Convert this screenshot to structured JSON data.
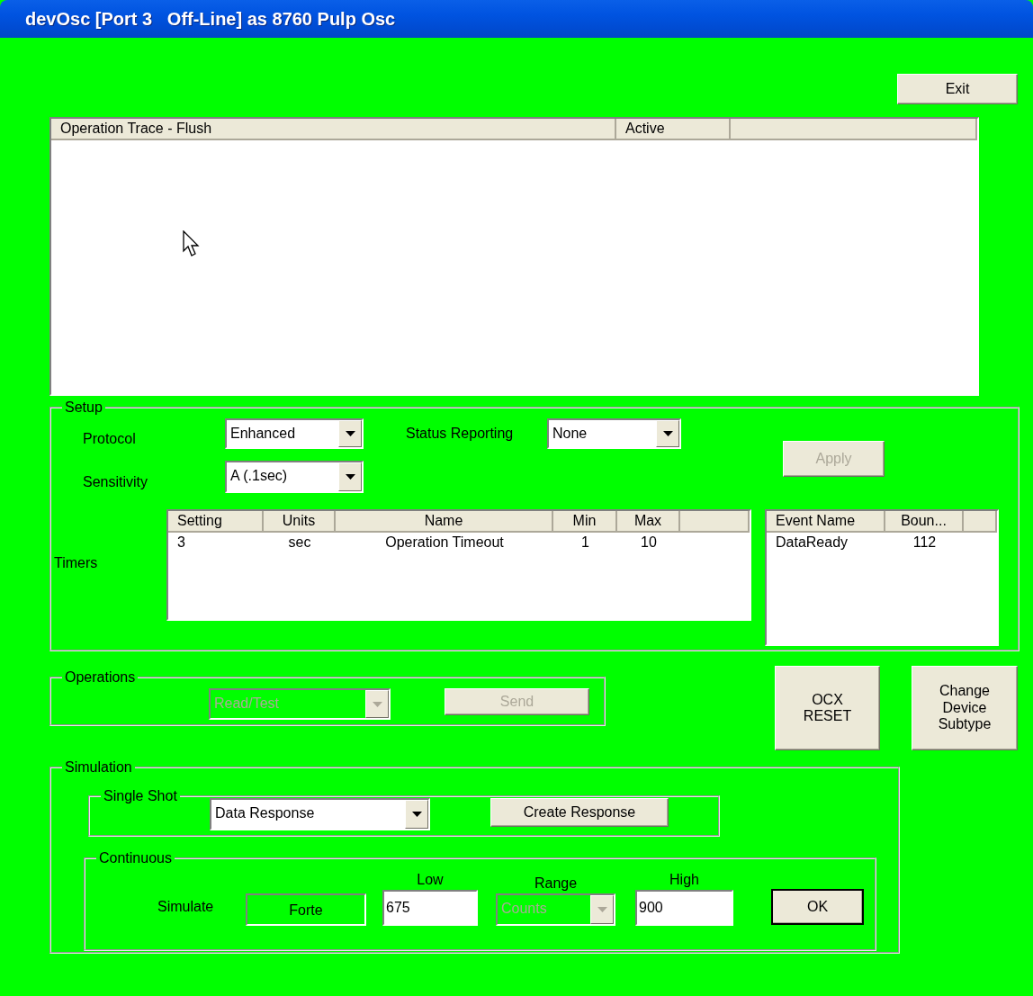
{
  "window": {
    "title": "devOsc [Port 3   Off-Line] as 8760 Pulp Osc"
  },
  "exit_button": {
    "label": "Exit"
  },
  "trace_list": {
    "columns": [
      "Operation Trace - Flush",
      "Active"
    ]
  },
  "setup": {
    "legend": "Setup",
    "protocol": {
      "label": "Protocol",
      "value": "Enhanced"
    },
    "status_reporting": {
      "label": "Status Reporting",
      "value": "None"
    },
    "sensitivity": {
      "label": "Sensitivity",
      "value": "A (.1sec)"
    },
    "apply_button": {
      "label": "Apply",
      "disabled": true
    },
    "timers": {
      "label": "Timers",
      "columns": [
        "Setting",
        "Units",
        "Name",
        "Min",
        "Max"
      ],
      "rows": [
        [
          "3",
          "sec",
          "Operation Timeout",
          "1",
          "10"
        ]
      ]
    },
    "events": {
      "columns": [
        "Event Name",
        "Boun..."
      ],
      "rows": [
        [
          "DataReady",
          "112"
        ]
      ]
    }
  },
  "operations": {
    "legend": "Operations",
    "operation": {
      "value": "Read/Test",
      "disabled": true
    },
    "send_button": {
      "label": "Send",
      "disabled": true
    }
  },
  "ocx_reset_button": {
    "lines": [
      "OCX",
      "RESET"
    ]
  },
  "change_subtype_button": {
    "lines": [
      "Change",
      "Device",
      "Subtype"
    ]
  },
  "simulation": {
    "legend": "Simulation",
    "single_shot": {
      "legend": "Single Shot",
      "response": {
        "value": "Data Response",
        "disabled": false
      },
      "create_button": {
        "label": "Create Response",
        "disabled": false
      }
    },
    "continuous": {
      "legend": "Continuous",
      "simulate_label": "Simulate",
      "simulate_value": "Forte",
      "low": {
        "label": "Low",
        "value": "675"
      },
      "range": {
        "label": "Range",
        "value": "Counts",
        "disabled": true
      },
      "high": {
        "label": "High",
        "value": "900"
      },
      "ok_button": {
        "label": "OK",
        "default": true
      }
    }
  }
}
